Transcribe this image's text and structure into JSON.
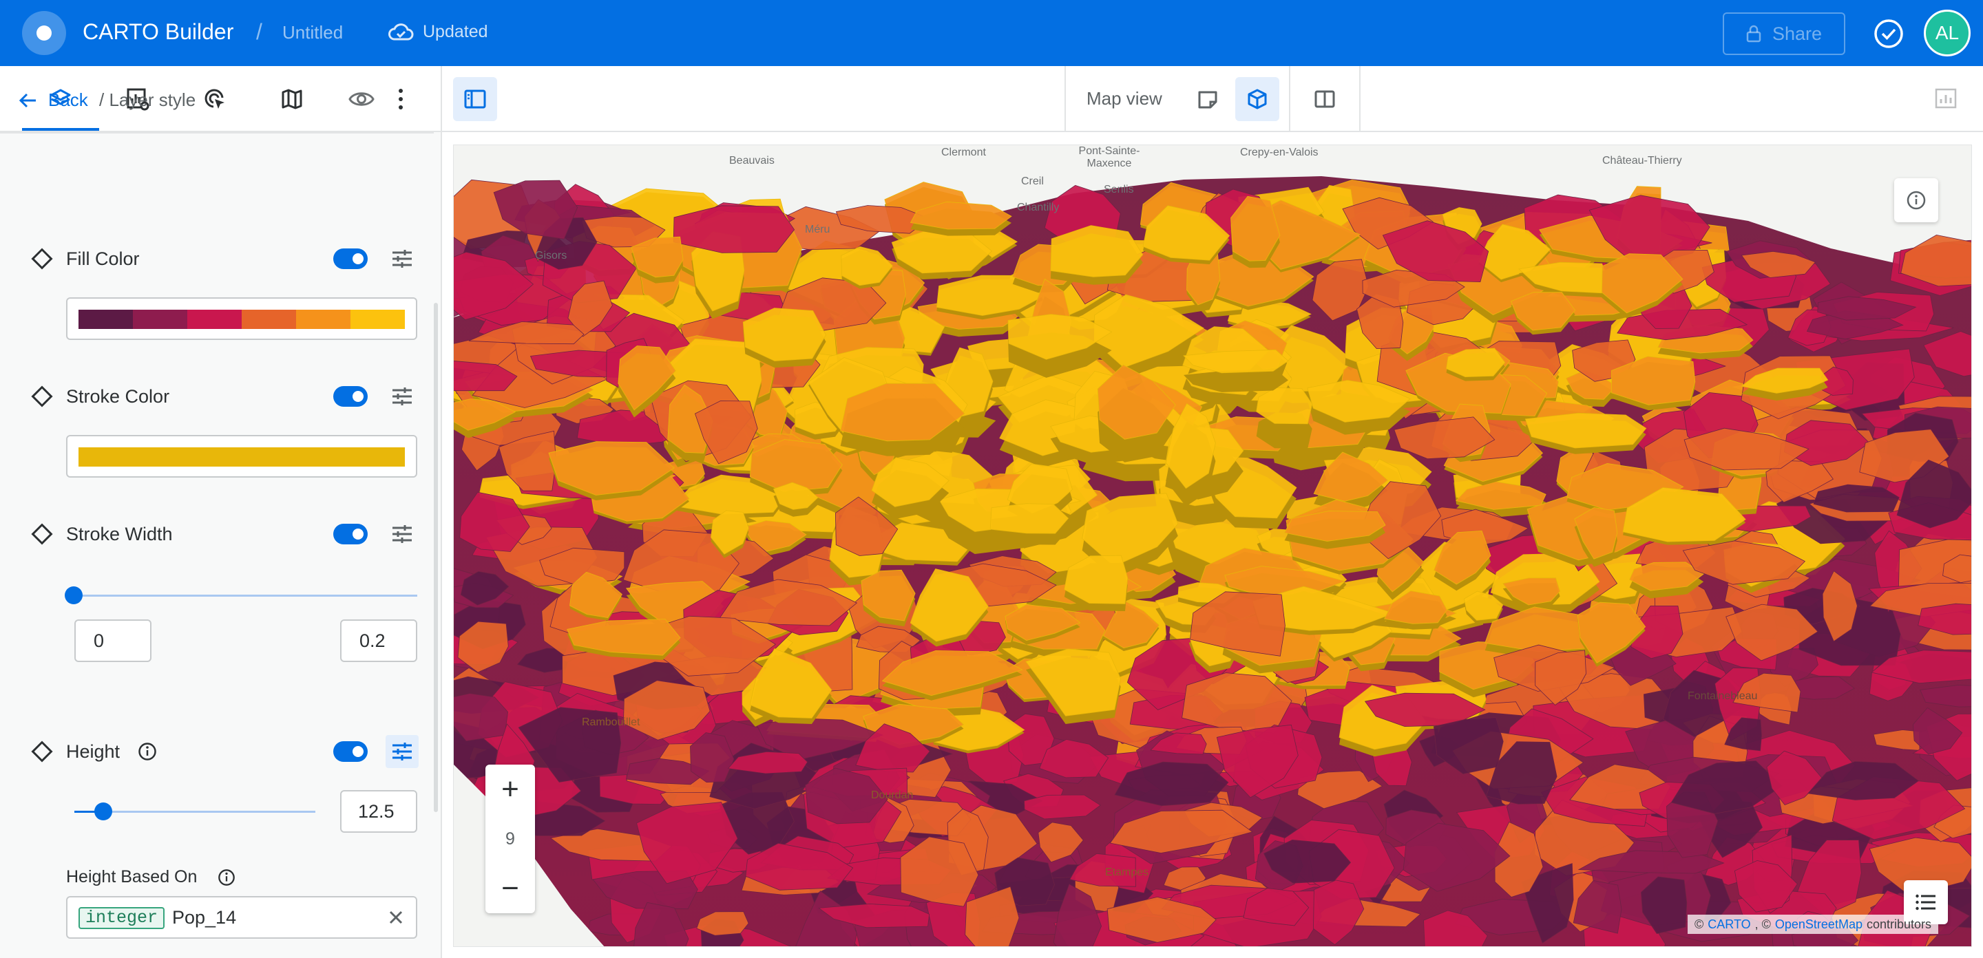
{
  "header": {
    "app_title": "CARTO Builder",
    "separator": "/",
    "map_name": "Untitled",
    "save_status": "Updated",
    "share_label": "Share",
    "avatar_initials": "AL",
    "colors": {
      "bar": "#036fe2",
      "avatar": "#1ec09f"
    }
  },
  "sidebar": {
    "tabs": [
      {
        "icon": "layers-icon",
        "active": true
      },
      {
        "icon": "widgets-settings-icon",
        "active": false
      },
      {
        "icon": "interactions-icon",
        "active": false
      },
      {
        "icon": "basemap-icon",
        "active": false
      }
    ],
    "breadcrumb": {
      "back_label": "Back",
      "path": "/ Layer style"
    },
    "properties": {
      "fill_color": {
        "label": "Fill Color",
        "enabled": true,
        "palette": [
          "#5c1a45",
          "#8e1c4e",
          "#c9174e",
          "#e6642a",
          "#f5921b",
          "#fcc20e"
        ]
      },
      "stroke_color": {
        "label": "Stroke Color",
        "enabled": true,
        "color": "#e8b70a"
      },
      "stroke_width": {
        "label": "Stroke Width",
        "enabled": true,
        "min": "0",
        "max": "0.2",
        "value": 0
      },
      "height": {
        "label": "Height",
        "enabled": true,
        "value": "12.5",
        "slider_fraction": 0.12,
        "based_on_label": "Height Based On",
        "based_on_type": "integer",
        "based_on_value": "Pop_14"
      }
    }
  },
  "map_toolbar": {
    "view_label": "Map view"
  },
  "map": {
    "zoom_level": "9",
    "zoom_in": "+",
    "zoom_out": "−",
    "labels": [
      "Clermont",
      "Pont-Sainte-Maxence",
      "Crepy-en-Valois",
      "Beauvais",
      "Creil",
      "Senlis",
      "Château-Thierry",
      "Chantilly",
      "Méru",
      "Gisors",
      "Rambouillet",
      "Dourdan",
      "Etampes",
      "Fontainebleau"
    ],
    "attribution": {
      "prefix": "©",
      "carto": "CARTO",
      "separator": ", ©",
      "osm": "OpenStreetMap",
      "suffix": "contributors"
    }
  }
}
